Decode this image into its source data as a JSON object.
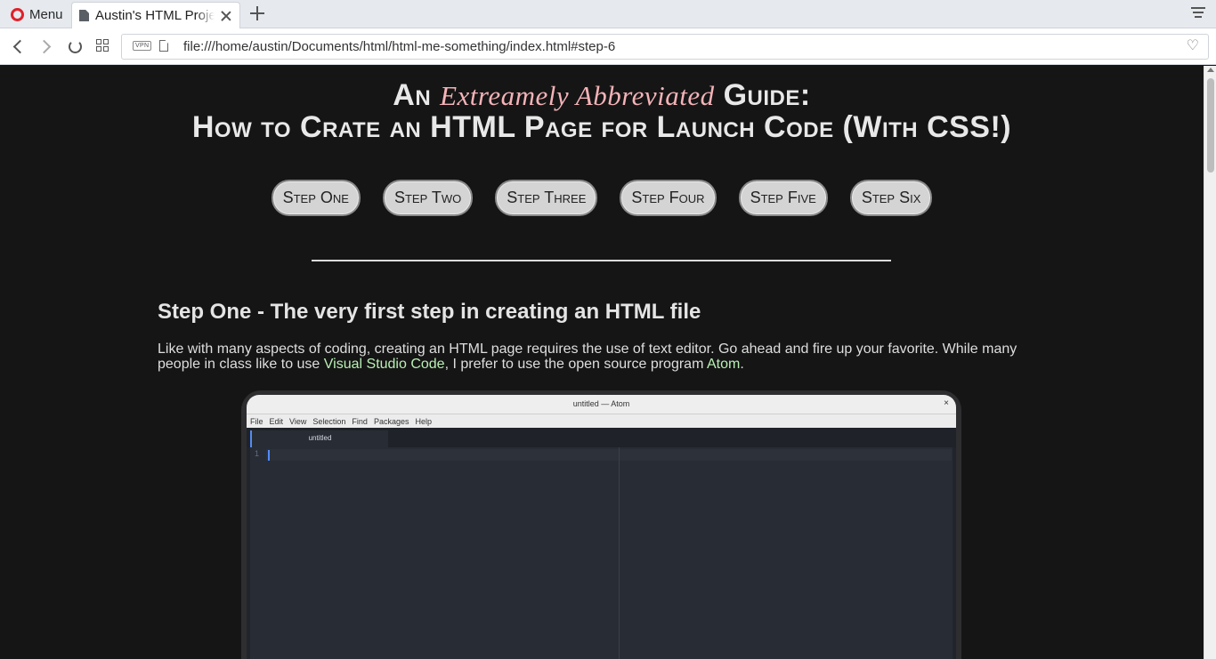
{
  "browser": {
    "menu_label": "Menu",
    "tab_title": "Austin's HTML Project",
    "url": "file:///home/austin/Documents/html/html-me-something/index.html#step-6",
    "vpn_label": "VPN"
  },
  "header": {
    "line1_prefix": "An",
    "line1_emphasis": "Extreamely Abbreviated",
    "line1_suffix": "Guide:",
    "line2": "How to Crate an HTML Page for Launch Code (With CSS!)"
  },
  "steps_nav": [
    {
      "label": "Step One"
    },
    {
      "label": "Step Two"
    },
    {
      "label": "Step Three"
    },
    {
      "label": "Step Four"
    },
    {
      "label": "Step Five"
    },
    {
      "label": "Step Six"
    }
  ],
  "step_one": {
    "title": "Step One - The very first step in creating an HTML file",
    "para_part1": "Like with many aspects of coding, creating an HTML page requires the use of text editor. Go ahead and fire up your favorite. While many people in class like to use ",
    "link_vscode": "Visual Studio Code",
    "para_part2": ", I prefer to use the open source program ",
    "link_atom": "Atom",
    "para_part3": "."
  },
  "atom_screenshot": {
    "window_title": "untitled — Atom",
    "close_glyph": "×",
    "menu": [
      "File",
      "Edit",
      "View",
      "Selection",
      "Find",
      "Packages",
      "Help"
    ],
    "tab_label": "untitled",
    "line_number": "1"
  },
  "colors": {
    "page_bg": "#151515",
    "heading_emphasis": "#f4b3b8",
    "link": "#b9f0b4",
    "button_bg": "#d4d4d4"
  }
}
